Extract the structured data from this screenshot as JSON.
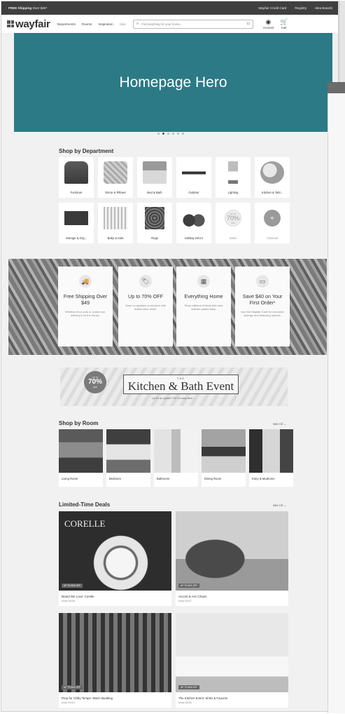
{
  "topbar": {
    "promo_bold": "FREE Shipping",
    "promo_rest": " Over $49*",
    "links": [
      "Wayfair Credit Card",
      "Registry",
      "Idea Boards"
    ]
  },
  "header": {
    "logo": "wayfair",
    "nav": [
      "Departments",
      "Rooms",
      "Inspiration",
      "Sale"
    ],
    "search_placeholder": "Find anything for your home...",
    "account_label": "Account",
    "cart_label": "Cart"
  },
  "hero": {
    "label": "Homepage Hero",
    "dots": 6,
    "active_dot": 1
  },
  "departments": {
    "title": "Shop by Department",
    "items": [
      {
        "label": "Furniture",
        "pic": "chair"
      },
      {
        "label": "Décor & Pillows",
        "pic": "pillow"
      },
      {
        "label": "Bed & Bath",
        "pic": "bed"
      },
      {
        "label": "Outdoor",
        "pic": "outdoor"
      },
      {
        "label": "Lighting",
        "pic": "lamp"
      },
      {
        "label": "Kitchen & Tabl...",
        "pic": "kitchen"
      },
      {
        "label": "Storage & Org...",
        "pic": "storage"
      },
      {
        "label": "Baby & Kids",
        "pic": "baby"
      },
      {
        "label": "Rugs",
        "pic": "rugs"
      },
      {
        "label": "Holiday Décor",
        "pic": "holiday"
      },
      {
        "label": "Sales",
        "pic": "sales"
      },
      {
        "label": "Closeout",
        "pic": "clearout"
      }
    ],
    "sales_badge": {
      "top": "UP TO",
      "pct": "70%",
      "bottom": "OFF"
    }
  },
  "value_props": [
    {
      "icon": "truck-icon",
      "glyph": "🚚",
      "title": "Free Shipping Over $49",
      "desc": "Whether it's a sofa or a steel set, delivery's on the house."
    },
    {
      "icon": "tag-icon",
      "glyph": "🏷",
      "title": "Up to 70% OFF",
      "desc": "Save on updates of all sizes with limited-time deals."
    },
    {
      "icon": "boxes-icon",
      "glyph": "▦",
      "title": "Everything Home",
      "desc": "Shop millions of finds with new arrivals added daily."
    },
    {
      "icon": "credit-card-icon",
      "glyph": "▭",
      "title": "Save $40 on Your First Order¹",
      "desc": "Use the Wayfair Card for exclusive savings and financing options."
    }
  ],
  "kitchen_banner": {
    "badge_top": "UP TO",
    "badge_pct": "70%",
    "badge_bottom": "OFF",
    "the": "THE",
    "title": "Kitchen & Bath Event",
    "subtitle": "Up for an update? DIY for easy fixes →"
  },
  "rooms": {
    "title": "Shop by Room",
    "see_all": "See All →",
    "items": [
      {
        "label": "Living Room",
        "img": "living"
      },
      {
        "label": "Bedroom",
        "img": "bedroom"
      },
      {
        "label": "Bathroom",
        "img": "bathroom"
      },
      {
        "label": "Dining Room",
        "img": "dining"
      },
      {
        "label": "Entry & Mudroom",
        "img": "entry"
      }
    ]
  },
  "deals": {
    "title": "Limited-Time Deals",
    "see_all": "See All →",
    "items": [
      {
        "title": "Brand We Love: Corelle",
        "ends": "ends 09/28",
        "tag": "UP TO 40% OFF",
        "brand": "CORELLE",
        "img": "corelle"
      },
      {
        "title": "Accent & Arm Chairs",
        "ends": "ends 09/27",
        "tag": "UP TO 60% OFF",
        "brand": "",
        "img": "chairs"
      },
      {
        "title": "Prep for Chilly Temps: Warm Bedding",
        "ends": "ends 09/10",
        "tag": "UP TO 50% OFF",
        "brand": "",
        "img": "bedding"
      },
      {
        "title": "The Kitchen Event: Sinks & Faucets",
        "ends": "ends 09/30",
        "tag": "UP TO 60% OFF",
        "brand": "",
        "img": "sinks"
      }
    ]
  }
}
